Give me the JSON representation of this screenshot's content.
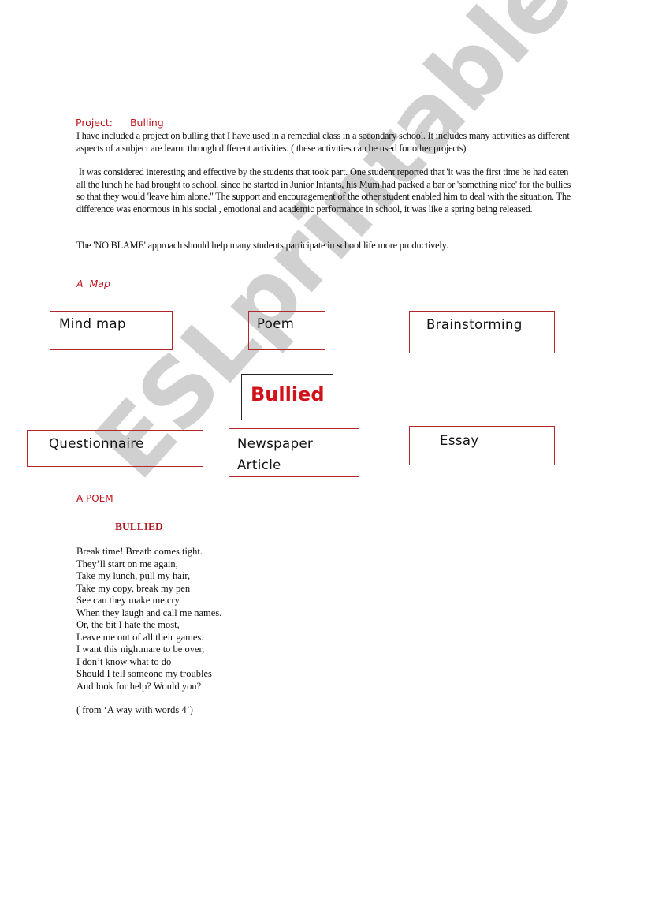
{
  "header": {
    "project_label": "Project:",
    "project_name": "Bulling"
  },
  "intro": {
    "paragraph_1": "I have included a project on bulling that I have used in a remedial class in a secondary school. It includes many activities as different aspects of a subject are learnt through different activities. ( these activities can be used for other projects)",
    "paragraph_2": " It was considered interesting and effective by the students that took part. One student reported that 'it was the first time he had eaten all the lunch he had brought to school. since he started in Junior Infants, his Mum had packed a bar or 'something nice' for the bullies so that they would 'leave him alone.'' The support and encouragement of the other student enabled him to deal with the situation. The difference was enormous in his social , emotional and academic performance in school, it was like a spring being released.",
    "paragraph_3": "The 'NO BLAME' approach should help many students participate in school life more productively."
  },
  "map": {
    "heading": "A  Map",
    "center": "Bullied",
    "nodes": {
      "mind_map": "Mind map",
      "poem": "Poem",
      "brainstorming": "Brainstorming",
      "questionnaire": "Questionnaire",
      "newspaper_line1": "Newspaper",
      "newspaper_line2": "Article",
      "essay": "Essay"
    }
  },
  "poem": {
    "heading": "A POEM",
    "title": "BULLIED",
    "lines": [
      "Break time! Breath comes tight.",
      "They’ll start on me again,",
      "Take my lunch, pull my hair,",
      "Take my copy, break my pen",
      "See can they make me cry",
      "When they laugh and call me names.",
      "Or, the bit I hate the most,",
      "Leave me out of all their games.",
      "I want this nightmare to be over,",
      "I don’t know what to do",
      "Should I tell someone my troubles",
      "And look for help? Would you?"
    ],
    "source": "( from ‘A way with words 4’)"
  },
  "watermark": "ESLprintables.com",
  "colors": {
    "accent_red": "#c0141c",
    "box_border": "#b5262b"
  }
}
